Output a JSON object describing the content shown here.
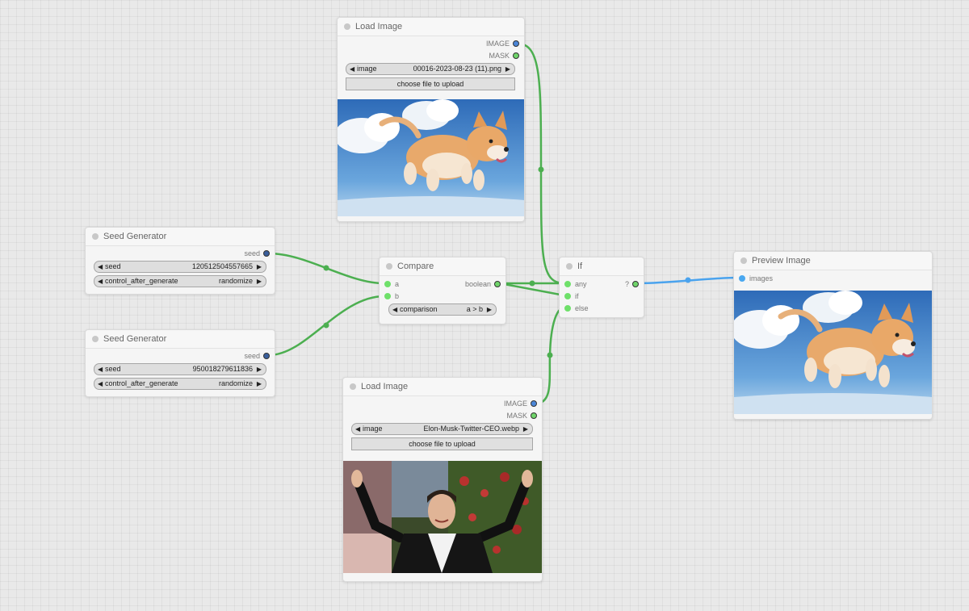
{
  "colors": {
    "image_link": "#4caf50",
    "seed_link": "#4caf50",
    "preview_link": "#4aa3ee",
    "background": "#e9e9e9"
  },
  "nodes": {
    "load_image_top": {
      "title": "Load Image",
      "outputs": [
        "IMAGE",
        "MASK"
      ],
      "image_widget": {
        "label": "image",
        "value": "00016-2023-08-23  (11).png"
      },
      "upload_label": "choose file to upload",
      "preview_subject": "flying shiba inu dog over blue sky with clouds"
    },
    "seed_generator_1": {
      "title": "Seed Generator",
      "output": "seed",
      "seed_widget": {
        "label": "seed",
        "value": "120512504557665"
      },
      "control_widget": {
        "label": "control_after_generate",
        "value": "randomize"
      }
    },
    "seed_generator_2": {
      "title": "Seed Generator",
      "output": "seed",
      "seed_widget": {
        "label": "seed",
        "value": "950018279611836"
      },
      "control_widget": {
        "label": "control_after_generate",
        "value": "randomize"
      }
    },
    "compare": {
      "title": "Compare",
      "inputs": [
        "a",
        "b"
      ],
      "output": "boolean",
      "comparison_widget": {
        "label": "comparison",
        "value": "a > b"
      }
    },
    "if": {
      "title": "If",
      "inputs": [
        "any",
        "if",
        "else"
      ],
      "output": "?"
    },
    "preview_image": {
      "title": "Preview Image",
      "input": "images",
      "preview_subject": "flying shiba inu dog over blue sky with clouds"
    },
    "load_image_bottom": {
      "title": "Load Image",
      "outputs": [
        "IMAGE",
        "MASK"
      ],
      "image_widget": {
        "label": "image",
        "value": "Elon-Musk-Twitter-CEO.webp"
      },
      "upload_label": "choose file to upload",
      "preview_subject": "man in tuxedo waving both arms at crowd"
    }
  }
}
